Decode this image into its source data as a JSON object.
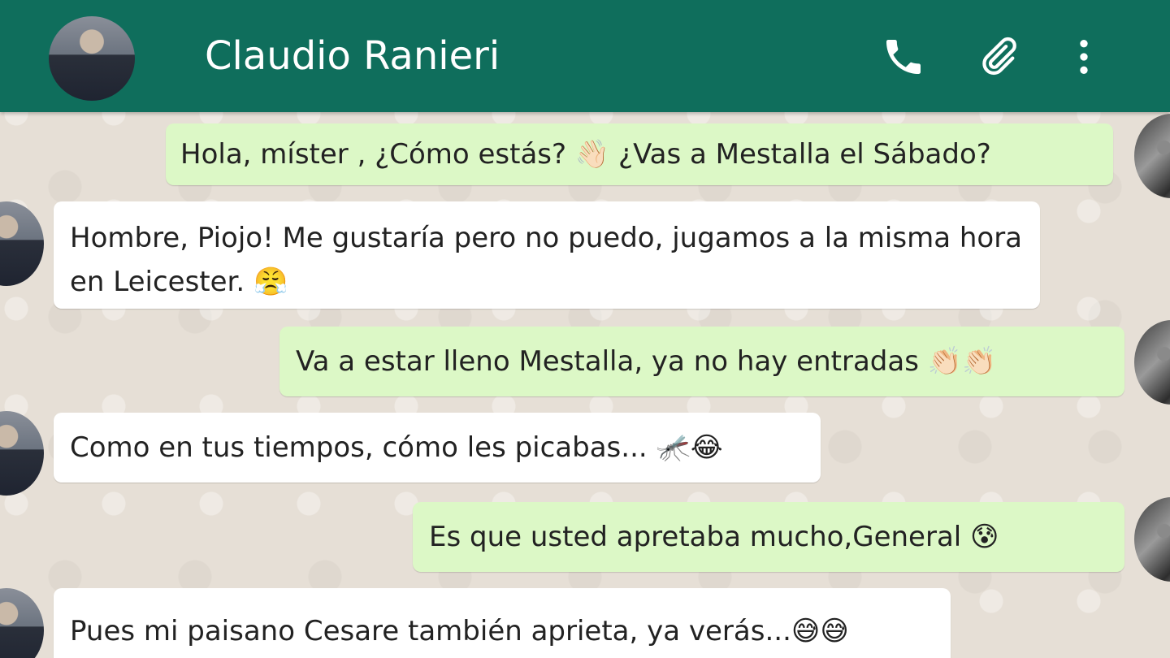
{
  "header": {
    "contact_name": "Claudio Ranieri",
    "icons": [
      "phone-icon",
      "paperclip-icon",
      "more-vert-icon"
    ],
    "color": "#0f6e5c"
  },
  "colors": {
    "outgoing_bubble": "#dcf8c6",
    "incoming_bubble": "#ffffff",
    "wallpaper": "#e6dfd6"
  },
  "messages": [
    {
      "direction": "outgoing",
      "text": "Hola,  míster , ¿Cómo estás? 👋🏻 ¿Vas a Mestalla el Sábado?"
    },
    {
      "direction": "incoming",
      "line1": "Hombre, Piojo! Me gustaría pero no puedo, jugamos a la misma hora",
      "line2": "en Leicester. 😤"
    },
    {
      "direction": "outgoing",
      "text": "Va a estar lleno Mestalla, ya no hay entradas 👏🏻👏🏻"
    },
    {
      "direction": "incoming",
      "text": "Como en tus tiempos, cómo les picabas... 🦟😂"
    },
    {
      "direction": "outgoing",
      "text": "Es que usted apretaba mucho,General 😰"
    },
    {
      "direction": "incoming",
      "text": "Pues mi paisano Cesare también aprieta, ya verás...😅😅"
    }
  ]
}
